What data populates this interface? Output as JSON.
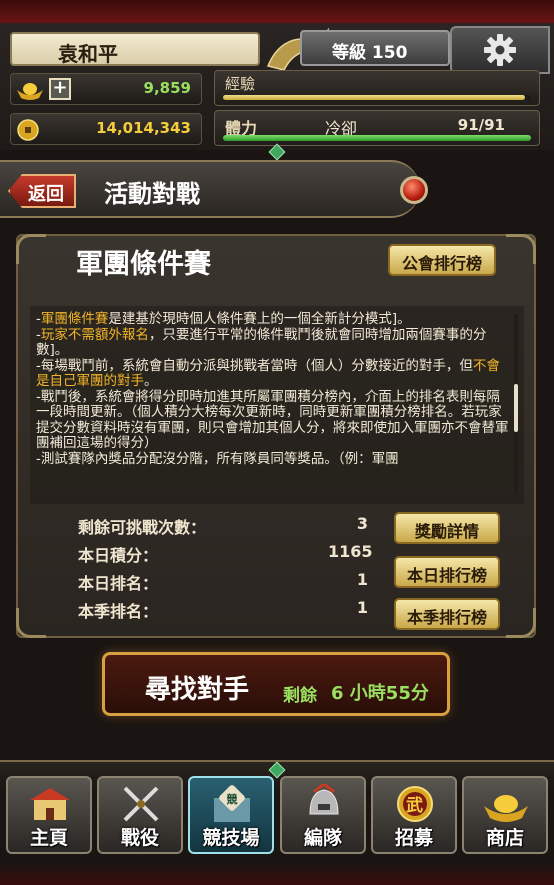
{
  "player": {
    "name": "袁和平",
    "level_text": "等級 150",
    "gold": "9,859",
    "coins": "14,014,343",
    "exp_label": "經驗",
    "exp_progress": 0.98,
    "stamina_label": "體力",
    "stamina_status": "冷卻",
    "stamina_value": "91/91",
    "stamina_progress": 1.0
  },
  "header": {
    "back_label": "返回",
    "title": "活動對戰"
  },
  "panel": {
    "title": "軍團條件賽",
    "guild_rank_label": "公會排行榜",
    "description": [
      {
        "parts": [
          [
            "-",
            ""
          ],
          [
            "軍團條件賽",
            "hl"
          ],
          [
            "是建基於現時個人條件賽上的一個全新計分模式]。",
            ""
          ]
        ]
      },
      {
        "parts": [
          [
            "-",
            ""
          ],
          [
            "玩家不需額外報名",
            "hl"
          ],
          [
            "，只要進行平常的條件戰鬥後就會同時增加兩個賽事的分數]。",
            ""
          ]
        ]
      },
      {
        "parts": [
          [
            "-每場戰鬥前，系統會自動分派與挑戰者當時（個人）分數接近的對手，但",
            ""
          ],
          [
            "不會是自己軍團的對手",
            "hl"
          ],
          [
            "。",
            ""
          ]
        ]
      },
      {
        "parts": [
          [
            "-戰鬥後，系統會將得分即時加進其所屬軍團積分榜內，介面上的排名表則每隔一段時間更新。（個人積分大榜每次更新時，同時更新軍團積分榜排名。若玩家提交分數資料時沒有軍團，則只會增加其個人分，將來即使加入軍團亦不會替軍團補回這場的得分）",
            ""
          ]
        ]
      },
      {
        "parts": [
          [
            "-測試賽隊內獎品分配沒分階，所有隊員同等獎品。（例：軍團",
            ""
          ]
        ]
      }
    ],
    "stats": [
      {
        "label": "剩餘可挑戰次數：",
        "value": "3"
      },
      {
        "label": "本日積分：",
        "value": "1165"
      },
      {
        "label": "本日排名：",
        "value": "1"
      },
      {
        "label": "本季排名：",
        "value": "1"
      }
    ],
    "reward_btn": "獎勵詳情",
    "daily_rank_btn": "本日排行榜",
    "season_rank_btn": "本季排行榜"
  },
  "search": {
    "label": "尋找對手",
    "remain_label": "剩餘",
    "remain_value": "6 小時55分"
  },
  "nav": [
    {
      "label": "主頁",
      "icon": "palace-icon"
    },
    {
      "label": "戰役",
      "icon": "crossed-swords-icon"
    },
    {
      "label": "競技場",
      "icon": "arena-icon",
      "active": true
    },
    {
      "label": "編隊",
      "icon": "helmet-icon"
    },
    {
      "label": "招募",
      "icon": "recruit-coin-icon",
      "badge": "武"
    },
    {
      "label": "商店",
      "icon": "gold-ingot-icon"
    }
  ],
  "colors": {
    "accent_gold": "#c9a84a",
    "highlight": "#f0b428",
    "remain_green": "#9ae060",
    "exp_bar": "#f2e08a",
    "stamina_bar": "#2d9a2a"
  }
}
